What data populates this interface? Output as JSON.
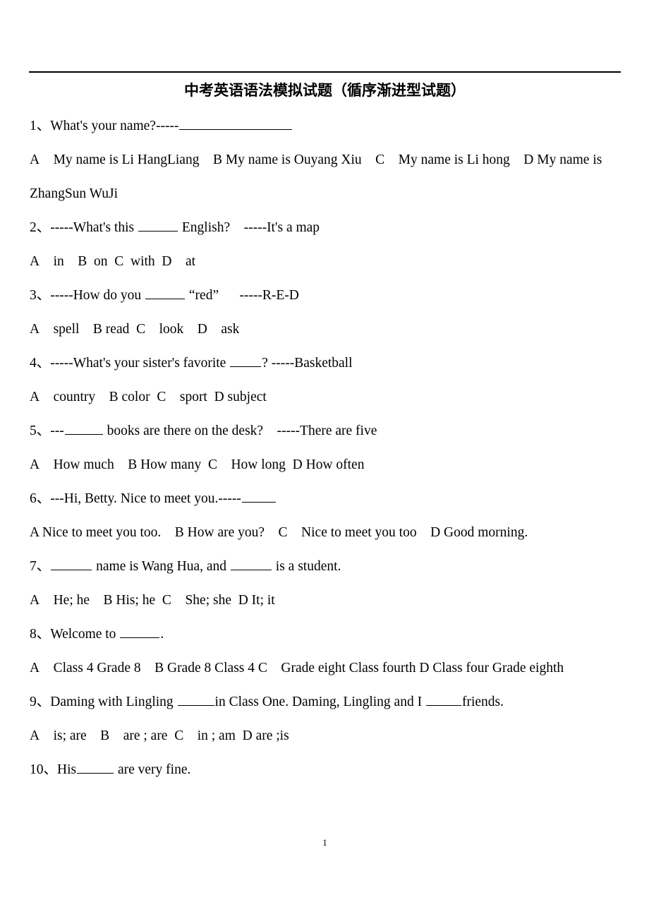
{
  "document": {
    "title": "中考英语语法模拟试题（循序渐进型试题）",
    "page_number": "1"
  },
  "questions": [
    {
      "id": "q1",
      "stem_prefix": "1、What's your name?-----",
      "stem_suffix": "",
      "options_lines": [
        "A My name is Li HangLiang B My name is Ouyang Xiu C  My name is Li hong D My name is ZhangSun WuJi"
      ]
    },
    {
      "id": "q2",
      "stem_prefix": "2、-----What's this ",
      "stem_suffix": " English? -----It's a map",
      "options_lines": [
        "A  in B on C with D  at"
      ]
    },
    {
      "id": "q3",
      "stem_prefix": "3、-----How do you ",
      "stem_suffix": " “red”  -----R-E-D",
      "options_lines": [
        "A  spell B read C  look D  ask"
      ]
    },
    {
      "id": "q4",
      "stem_prefix": "4、-----What's your sister's favorite ",
      "stem_suffix": "? -----Basketball",
      "options_lines": [
        "A  country B color C  sport D subject"
      ]
    },
    {
      "id": "q5",
      "stem_prefix": "5、---",
      "stem_suffix": " books are there on the desk? -----There are five",
      "options_lines": [
        "A  How much B How many C  How long D How often"
      ]
    },
    {
      "id": "q6",
      "stem_prefix": "6、---Hi, Betty. Nice to meet you.-----",
      "stem_suffix": "",
      "options_lines": [
        "A Nice to meet you too. B How are you?  C  Nice to meet you too D Good morning."
      ]
    },
    {
      "id": "q7",
      "stem_prefix": "7、",
      "stem_mid": " name is Wang Hua, and ",
      "stem_suffix": " is a student.",
      "options_lines": [
        "A  He; he B His; he C  She; she D It; it"
      ]
    },
    {
      "id": "q8",
      "stem_prefix": "8、Welcome to ",
      "stem_suffix": ".",
      "options_lines": [
        "A  Class 4 Grade 8 B Grade 8 Class 4 C  Grade eight Class fourth D Class four Grade eighth"
      ]
    },
    {
      "id": "q9",
      "stem_prefix": "9、Daming with Lingling ",
      "stem_mid": "in Class One. Daming, Lingling and I ",
      "stem_suffix": "friends.",
      "options_lines": [
        "A  is; are B  are ; are C  in ; am D are ;is"
      ]
    },
    {
      "id": "q10",
      "stem_prefix": "10、His",
      "stem_suffix": " are very fine.",
      "options_lines": []
    }
  ]
}
